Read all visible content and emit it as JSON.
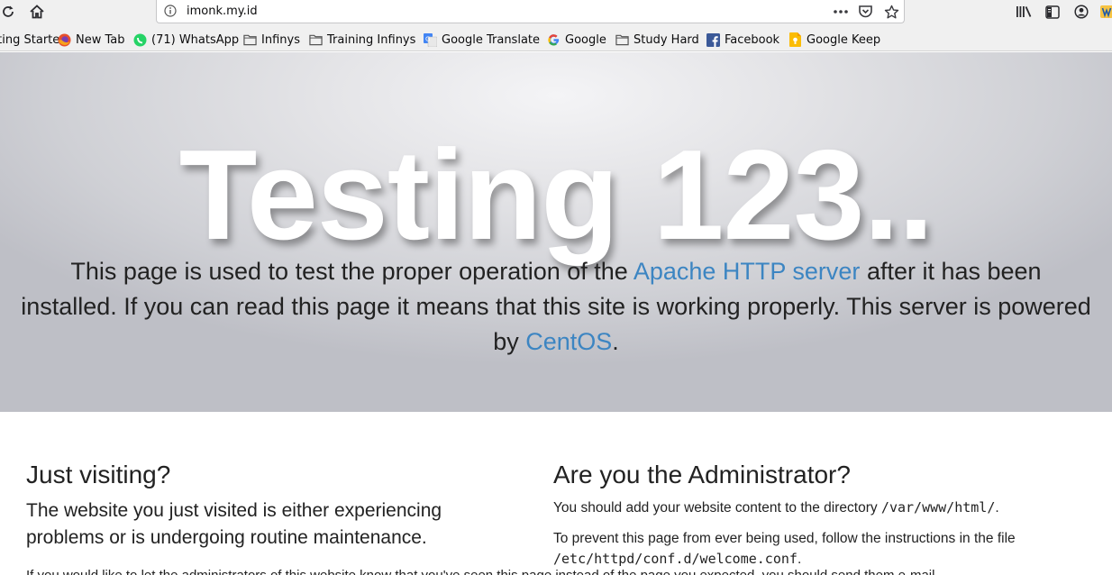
{
  "browser": {
    "url": "imonk.my.id",
    "nav_icons": [
      "reload-icon",
      "home-icon"
    ],
    "url_actions": [
      "page-actions-icon",
      "pocket-icon",
      "bookmark-star-icon"
    ],
    "toolbar_icons": [
      "library-icon",
      "sidebar-icon",
      "account-icon",
      "extension-icon"
    ]
  },
  "bookmarks": [
    {
      "label": "Getting Started",
      "icon": "firefox-icon"
    },
    {
      "label": "New Tab",
      "icon": "firefox-icon"
    },
    {
      "label": "(71) WhatsApp",
      "icon": "whatsapp-icon"
    },
    {
      "label": "Infinys",
      "icon": "folder-icon"
    },
    {
      "label": "Training Infinys",
      "icon": "folder-icon"
    },
    {
      "label": "Google Translate",
      "icon": "google-translate-icon"
    },
    {
      "label": "Google",
      "icon": "google-icon"
    },
    {
      "label": "Study Hard",
      "icon": "folder-icon"
    },
    {
      "label": "Facebook",
      "icon": "facebook-icon"
    },
    {
      "label": "Google Keep",
      "icon": "google-keep-icon"
    }
  ],
  "hero": {
    "title": "Testing 123..",
    "text_before": "This page is used to test the proper operation of the ",
    "apache_link": "Apache HTTP server",
    "text_middle": " after it has been installed. If you can read this page it means that this site is working properly. This server is powered by ",
    "centos_link": "CentOS",
    "text_end": "."
  },
  "visiting": {
    "heading": "Just visiting?",
    "lead": "The website you just visited is either experiencing problems or is undergoing routine maintenance.",
    "more": "If you would like to let the administrators of this website know that you've seen this page instead of the page you expected, you should send them e-mail."
  },
  "admin": {
    "heading": "Are you the Administrator?",
    "p1_text": "You should add your website content to the directory ",
    "p1_code": "/var/www/html/",
    "p1_end": ".",
    "p2_text": "To prevent this page from ever being used, follow the instructions in the file ",
    "p2_code": "/etc/httpd/conf.d/welcome.conf",
    "p2_end": "."
  },
  "colors": {
    "link": "#3c85c2",
    "chrome": "#f0f0f0"
  }
}
